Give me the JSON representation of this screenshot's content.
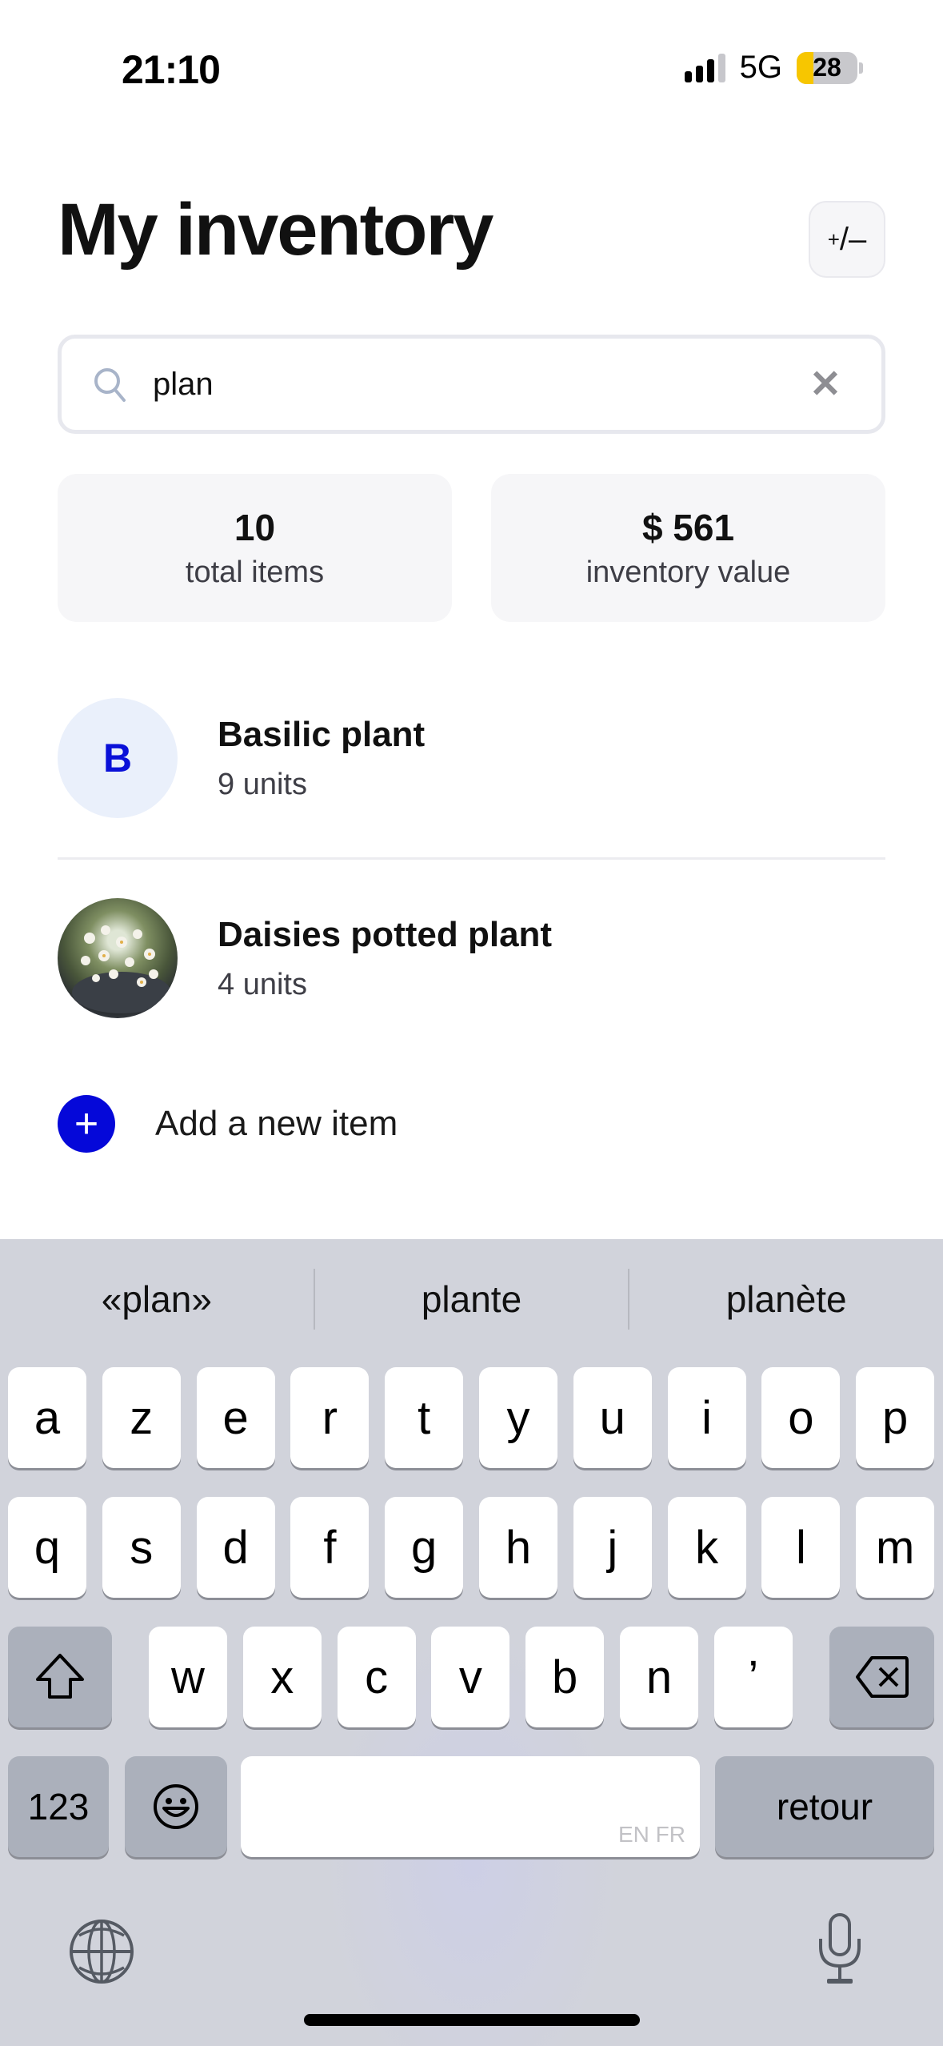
{
  "status_bar": {
    "time": "21:10",
    "network": "5G",
    "battery_level": "28",
    "battery_fraction": 0.28,
    "signal_bars_active": 3,
    "signal_bars_total": 4
  },
  "header": {
    "title": "My inventory",
    "adjust_button_plus": "+",
    "adjust_button_rest": "/–"
  },
  "search": {
    "value": "plan",
    "placeholder": "",
    "clear_icon": "✕"
  },
  "stats": {
    "total_items_value": "10",
    "total_items_label": "total items",
    "inventory_value_value": "$ 561",
    "inventory_value_label": "inventory value"
  },
  "items": [
    {
      "initial": "B",
      "name": "Basilic plant",
      "units": "9 units",
      "avatar": "letter"
    },
    {
      "initial": "",
      "name": "Daisies potted plant",
      "units": "4 units",
      "avatar": "photo"
    }
  ],
  "add_item": {
    "icon": "+",
    "label": "Add a new item"
  },
  "colors": {
    "accent": "#0508d9",
    "avatar_bg": "#eaf0fb",
    "battery_low": "#f7c600"
  },
  "keyboard": {
    "suggestions": [
      "«plan»",
      "plante",
      "planète"
    ],
    "row1": [
      "a",
      "z",
      "e",
      "r",
      "t",
      "y",
      "u",
      "i",
      "o",
      "p"
    ],
    "row2": [
      "q",
      "s",
      "d",
      "f",
      "g",
      "h",
      "j",
      "k",
      "l",
      "m"
    ],
    "row3": [
      "w",
      "x",
      "c",
      "v",
      "b",
      "n",
      "’"
    ],
    "numbers_key": "123",
    "return_key": "retour",
    "space_lang_hint": "EN FR"
  }
}
